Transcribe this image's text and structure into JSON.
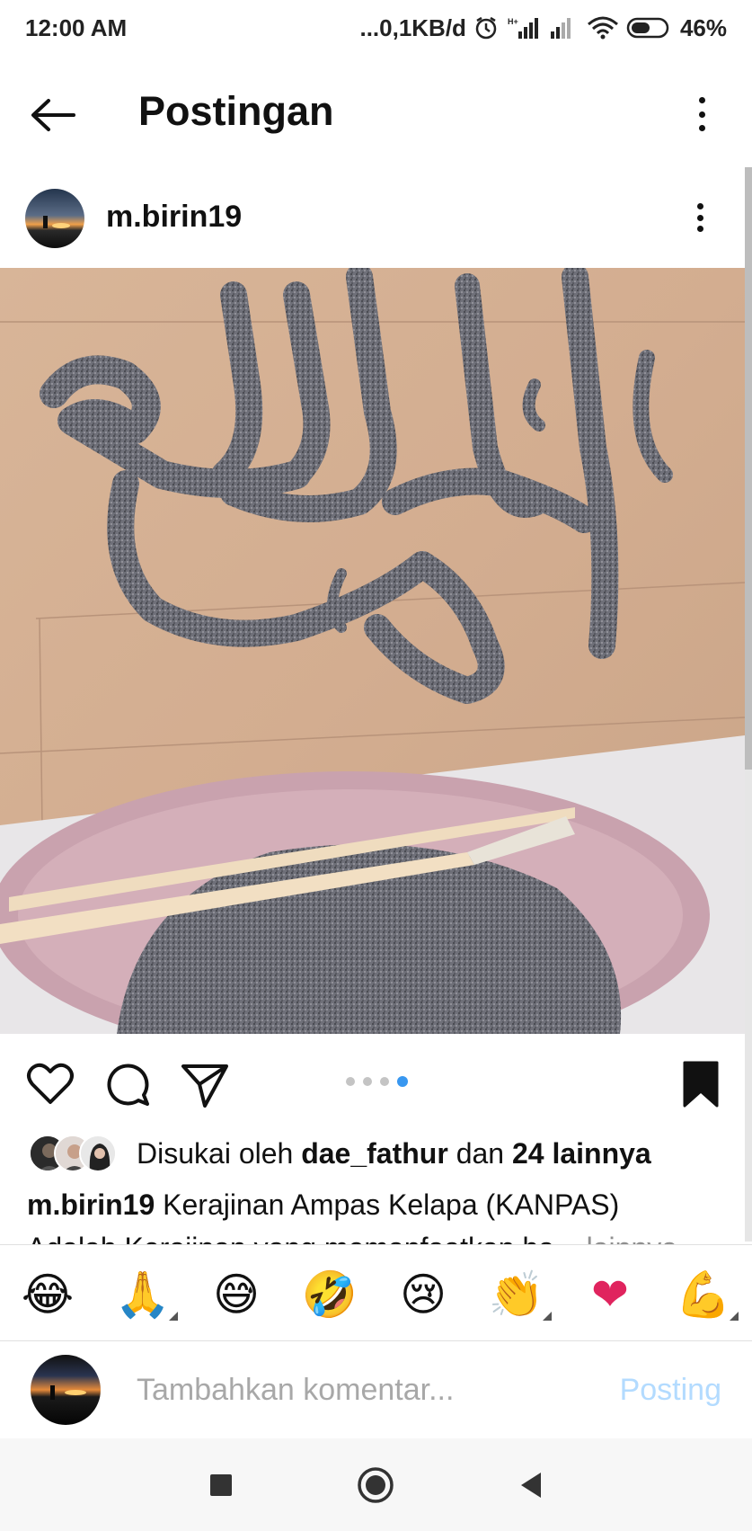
{
  "status_bar": {
    "time": "12:00 AM",
    "network_speed": "...0,1KB/d",
    "battery": "46%"
  },
  "header": {
    "title": "Postingan"
  },
  "post": {
    "username": "m.birin19",
    "likes": {
      "prefix": "Disukai oleh",
      "liker": "dae_fathur",
      "joiner": "dan",
      "others": "24 lainnya"
    },
    "caption": {
      "username": "m.birin19",
      "line1": "Kerajinan Ampas Kelapa (KANPAS)",
      "line2": "Adalah Kerajinan yang memanfaatkan ba...",
      "more": "lainnya"
    },
    "carousel": {
      "count": 4,
      "active_index": 3
    }
  },
  "emoji_bar": [
    "😂",
    "🙏",
    "😅",
    "🤣",
    "😢",
    "👏",
    "❤",
    "💪"
  ],
  "comment": {
    "placeholder": "Tambahkan komentar...",
    "post_label": "Posting"
  },
  "colors": {
    "accent": "#3897f0",
    "post_button_disabled": "#b3dbff",
    "heart": "#e0245e"
  }
}
